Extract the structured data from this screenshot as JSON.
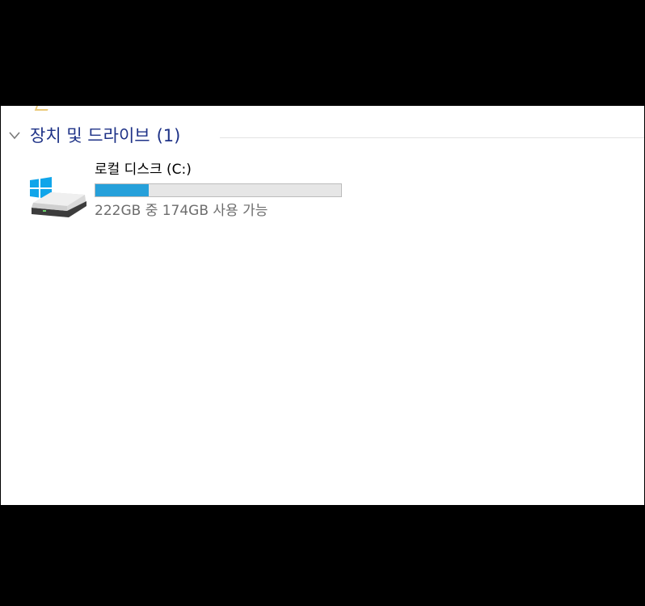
{
  "group": {
    "title": "장치 및 드라이브",
    "count": "(1)"
  },
  "drives": [
    {
      "name": "로컬 디스크 (C:)",
      "space_text": "222GB 중 174GB 사용 가능",
      "used_fraction": 0.216
    }
  ],
  "colors": {
    "group_title": "#1e3287",
    "bar_fill": "#26a0da",
    "bar_track": "#e6e6e6"
  },
  "icons": {
    "chevron": "chevron-down-icon",
    "drive": "windows-drive-icon"
  }
}
